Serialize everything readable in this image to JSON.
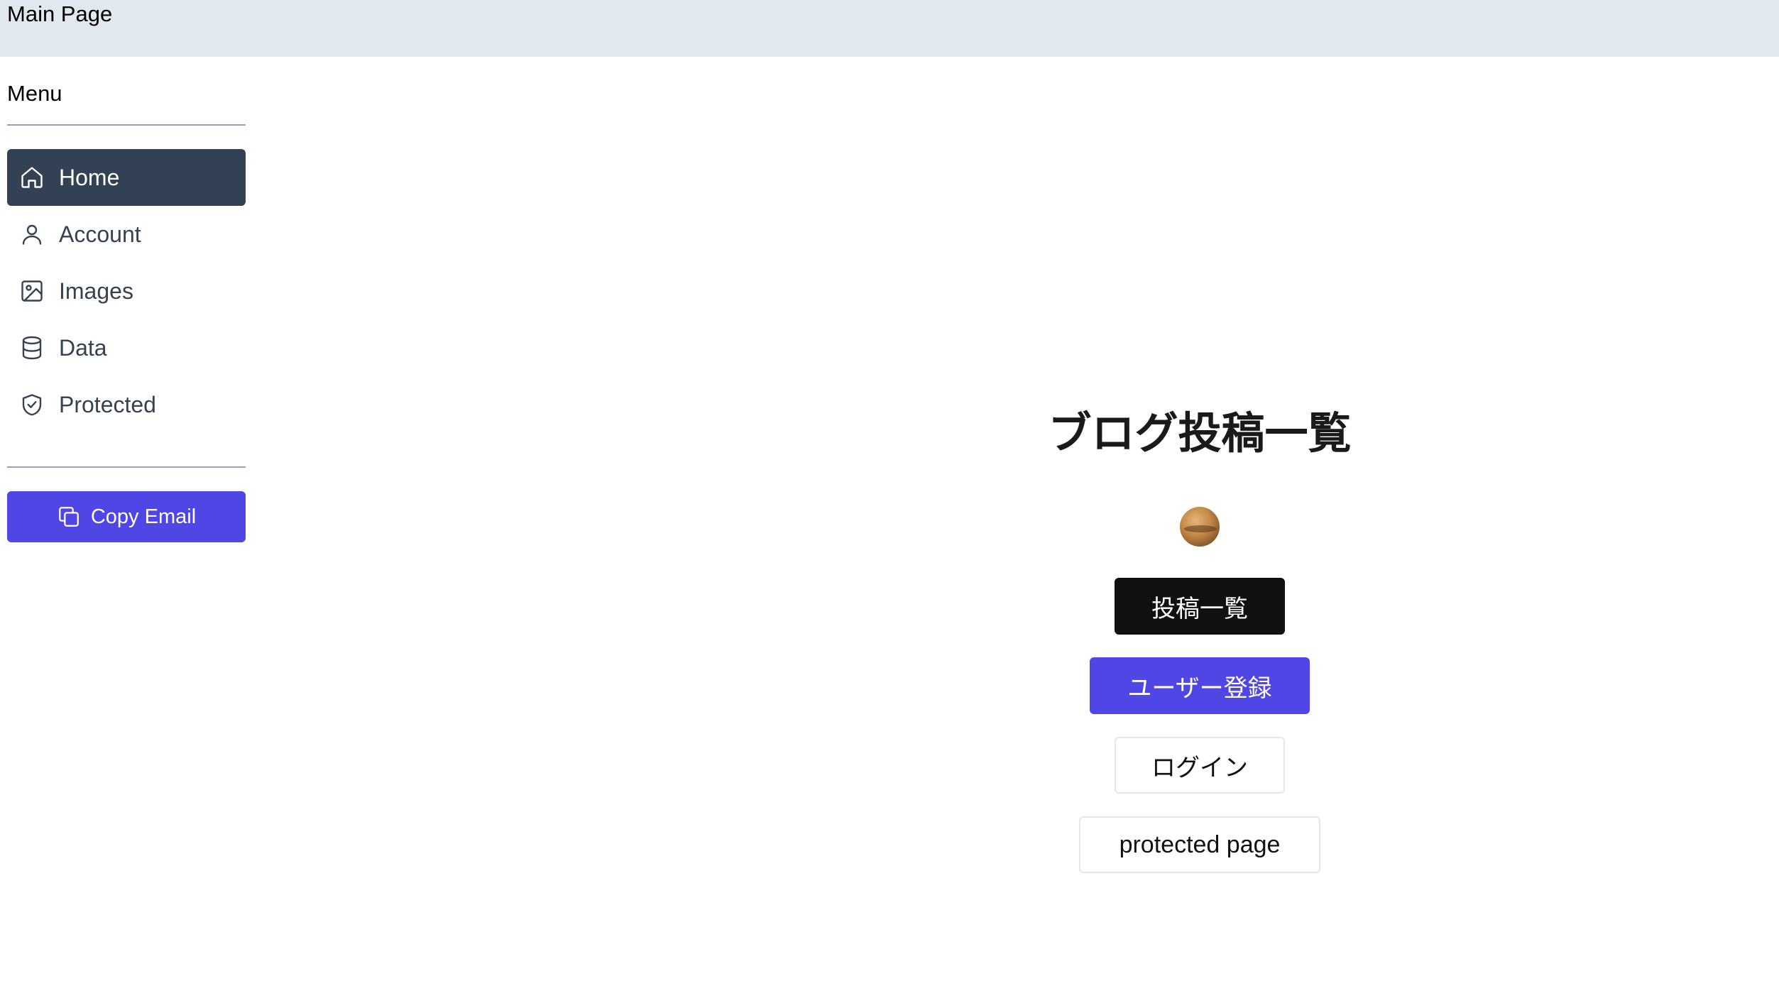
{
  "header": {
    "title": "Main Page"
  },
  "sidebar": {
    "heading": "Menu",
    "items": [
      {
        "label": "Home",
        "icon": "home-icon",
        "active": true
      },
      {
        "label": "Account",
        "icon": "user-icon",
        "active": false
      },
      {
        "label": "Images",
        "icon": "image-icon",
        "active": false
      },
      {
        "label": "Data",
        "icon": "database-icon",
        "active": false
      },
      {
        "label": "Protected",
        "icon": "shield-check-icon",
        "active": false
      }
    ],
    "copy_button": {
      "label": "Copy Email",
      "icon": "copy-icon"
    }
  },
  "main": {
    "heading": "ブログ投稿一覧",
    "buttons": {
      "posts": "投稿一覧",
      "register": "ユーザー登録",
      "login": "ログイン",
      "protected": "protected page"
    }
  },
  "colors": {
    "topbar_bg": "#e2e8f0",
    "active_nav_bg": "#334155",
    "accent": "#4f46e5",
    "dark_button": "#111111"
  }
}
